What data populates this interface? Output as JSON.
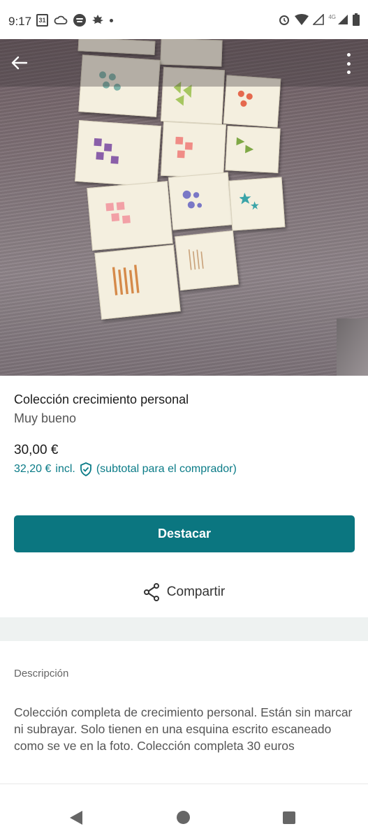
{
  "status_bar": {
    "time": "9:17",
    "calendar_day": "31",
    "network": "4G"
  },
  "listing": {
    "title": "Colección crecimiento personal",
    "condition": "Muy bueno",
    "price": "30,00 €",
    "buyer_price": "32,20 €",
    "buyer_price_suffix": "incl.",
    "buyer_price_note": "(subtotal para el comprador)",
    "highlight_button": "Destacar",
    "share_label": "Compartir",
    "description_heading": "Descripción",
    "description": "Colección completa de crecimiento personal. Están sin marcar ni subrayar. Solo tienen en una esquina escrito escaneado como se ve en la foto. Colección completa 30 euros"
  },
  "colors": {
    "accent": "#0b7680",
    "link_teal": "#0a7b87",
    "band": "#eef2f1"
  },
  "icons": {
    "back": "arrow-left-icon",
    "more": "more-vertical-icon",
    "shield": "shield-check-icon",
    "share": "share-icon"
  }
}
